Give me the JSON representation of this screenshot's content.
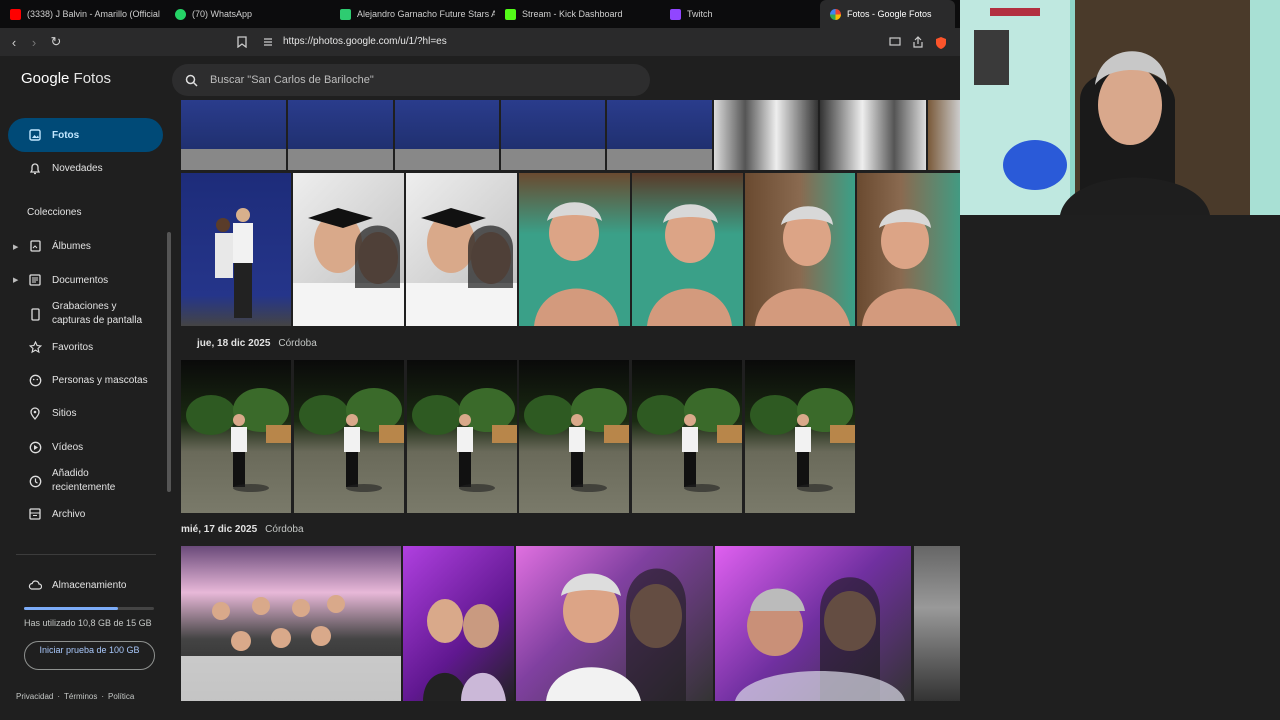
{
  "browser": {
    "tabs": [
      {
        "label": "(3338) J Balvin - Amarillo (Official",
        "icon": "youtube-icon",
        "color": "#ff0000"
      },
      {
        "label": "(70) WhatsApp",
        "icon": "whatsapp-icon",
        "color": "#25d366"
      },
      {
        "label": "Alejandro Garnacho Future Stars Aca",
        "icon": "doc-icon",
        "color": "#2ecc71"
      },
      {
        "label": "Stream - Kick Dashboard",
        "icon": "kick-icon",
        "color": "#53fc18"
      },
      {
        "label": "Twitch",
        "icon": "twitch-icon",
        "color": "#9146ff"
      },
      {
        "label": "Fotos - Google Fotos",
        "icon": "google-photos-icon",
        "color": "#fbbc04"
      }
    ],
    "url": "https://photos.google.com/u/1/?hl=es"
  },
  "app": {
    "logo_google": "Google",
    "logo_product": "Fotos",
    "search_placeholder": "Buscar \"San Carlos de Bariloche\""
  },
  "sidebar": {
    "items": [
      {
        "label": "Fotos"
      },
      {
        "label": "Novedades"
      }
    ],
    "collections_label": "Colecciones",
    "collections": [
      {
        "label": "Álbumes"
      },
      {
        "label": "Documentos"
      },
      {
        "label": "Grabaciones y capturas de pantalla"
      },
      {
        "label": "Favoritos"
      },
      {
        "label": "Personas y mascotas"
      },
      {
        "label": "Sitios"
      },
      {
        "label": "Vídeos"
      },
      {
        "label": "Añadido recientemente"
      },
      {
        "label": "Archivo"
      }
    ],
    "storage_label": "Almacenamiento",
    "storage_used_text": "Has utilizado 10,8 GB de 15 GB",
    "storage_fraction": 0.72,
    "trial_button": "Iniciar prueba de 100 GB",
    "footer": {
      "privacy": "Privacidad",
      "terms": "Términos",
      "policy": "Política"
    }
  },
  "groups": [
    {
      "date": "jue, 18 dic 2025",
      "location": "Córdoba"
    },
    {
      "date": "mié, 17 dic 2025",
      "location": "Córdoba"
    }
  ]
}
